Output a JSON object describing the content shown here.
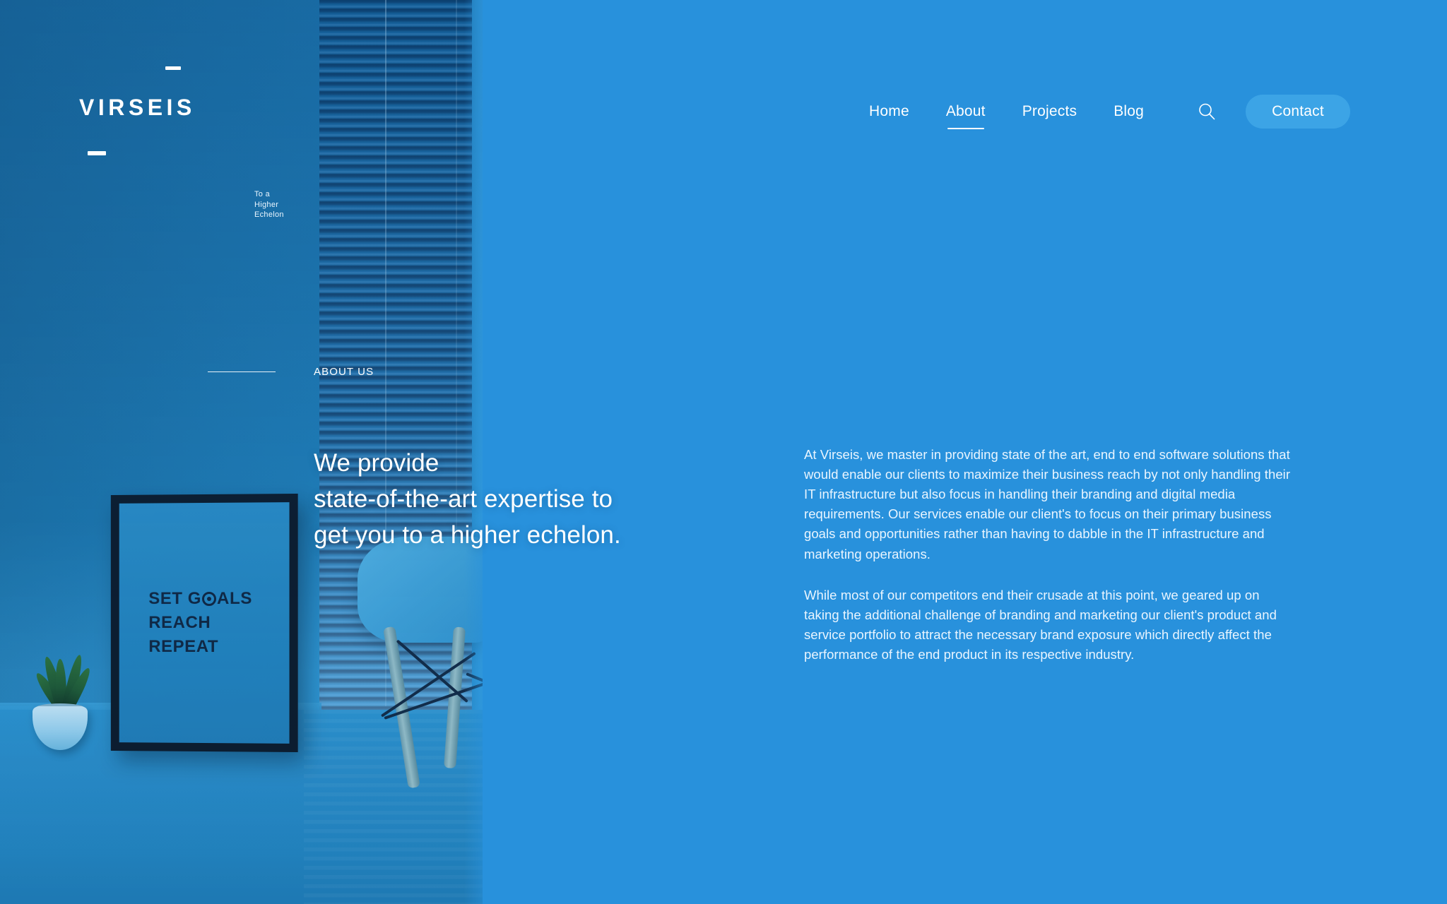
{
  "brand": {
    "name": "VIRSEIS",
    "tagline_line1": "To a",
    "tagline_line2": "Higher",
    "tagline_line3": "Echelon",
    "dash_top": "",
    "dash_bottom": ""
  },
  "nav": {
    "items": [
      {
        "label": "Home",
        "active": false
      },
      {
        "label": "About",
        "active": true
      },
      {
        "label": "Projects",
        "active": false
      },
      {
        "label": "Blog",
        "active": false
      }
    ],
    "search_icon": "search-icon",
    "contact_label": "Contact"
  },
  "section": {
    "eyebrow": "ABOUT US",
    "headline": "We provide\nstate-of-the-art expertise to\nget you to a higher echelon.",
    "paragraphs": [
      "At Virseis, we master in providing state of the art, end to end software solutions that would enable our clients to maximize their business reach by not only handling their IT infrastructure but also focus in handling their branding and digital media requirements. Our services enable our client's to focus on their primary business goals and opportunities rather than having to dabble in the IT infrastructure and marketing operations.",
      "While most of our competitors end their crusade at this point, we geared up on taking the additional challenge of branding and marketing our client's product and service portfolio to attract the necessary brand exposure which directly affect the performance of the end product in its respective industry."
    ]
  },
  "photo": {
    "poster": {
      "line1_a": "SET G",
      "line1_b": "ALS",
      "line2": "REACH",
      "line3": "REPEAT"
    }
  },
  "colors": {
    "brand_blue": "#2891dc",
    "deep_blue": "#1a6fa8",
    "contact_blue": "#3ca4e6",
    "text_white": "#ffffff",
    "body_text": "#e9f5ff",
    "poster_ink": "#0d1b33"
  }
}
